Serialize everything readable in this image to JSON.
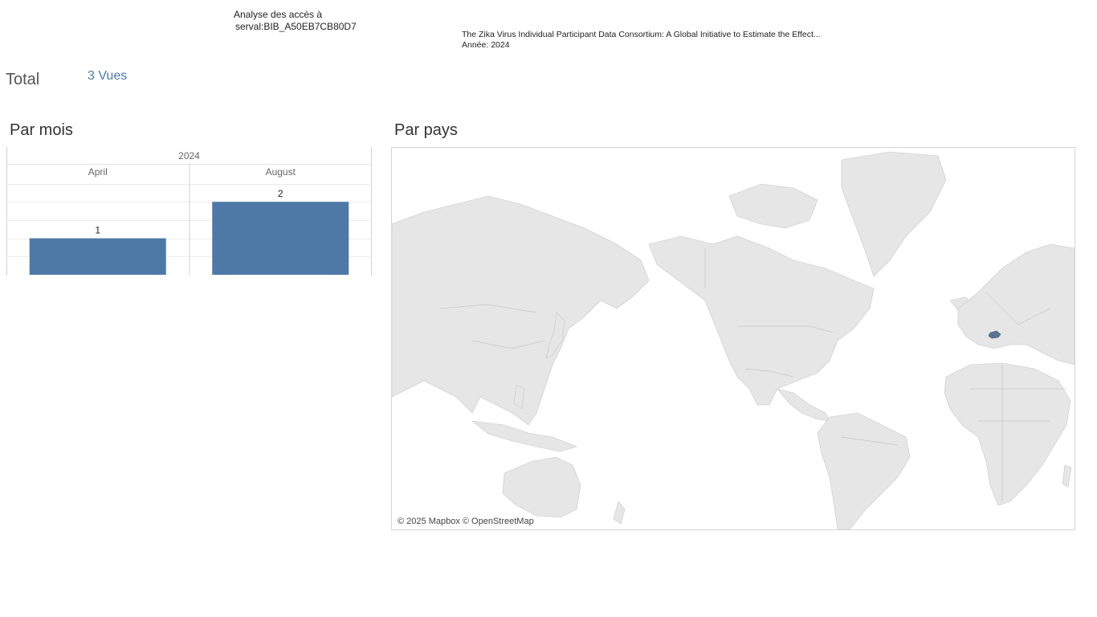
{
  "header": {
    "title_line1": "Analyse des accès à",
    "title_line2": "serval:BIB_A50EB7CB80D7",
    "doc_title": "The Zika Virus Individual Participant Data Consortium: A Global Initiative to Estimate the Effect...",
    "doc_year": "Année: 2024"
  },
  "total": {
    "label": "Total",
    "value": "3 Vues"
  },
  "sections": {
    "by_month": "Par mois",
    "by_country": "Par pays"
  },
  "colors": {
    "bar": "#4e79a7",
    "highlight_country": "#5a7590",
    "land": "#e8e8e8"
  },
  "chart_data": {
    "type": "bar",
    "title": "Par mois",
    "column_header": "2024",
    "categories": [
      "April",
      "August"
    ],
    "values": [
      1,
      2
    ],
    "ylim": [
      0,
      2.6
    ],
    "grid": true
  },
  "map": {
    "attribution": "© 2025 Mapbox © OpenStreetMap",
    "highlighted_country": "Switzerland"
  }
}
